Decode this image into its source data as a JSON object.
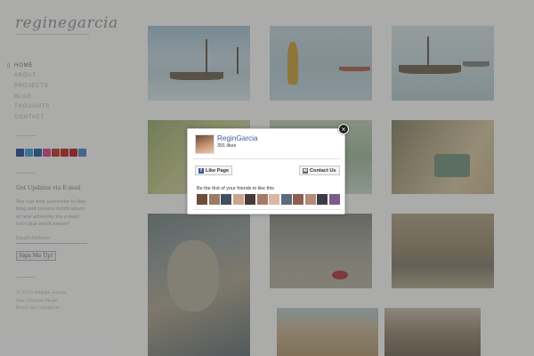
{
  "site": {
    "logo_text": "reginegarcia"
  },
  "nav": {
    "items": [
      {
        "label": "HOME",
        "active": true
      },
      {
        "label": "ABOUT",
        "active": false
      },
      {
        "label": "PROJECTS",
        "active": false
      },
      {
        "label": "BLOG",
        "active": false
      },
      {
        "label": "THOUGHTS",
        "active": false
      },
      {
        "label": "CONTACT",
        "active": false
      }
    ]
  },
  "social_icons": [
    {
      "name": "facebook-icon",
      "color": "#3b5998"
    },
    {
      "name": "twitter-icon",
      "color": "#4aa3d8"
    },
    {
      "name": "linkedin-icon",
      "color": "#2f6fa3"
    },
    {
      "name": "flickr-icon",
      "color": "#d9549a"
    },
    {
      "name": "google-plus-icon",
      "color": "#c5463a"
    },
    {
      "name": "youtube-icon",
      "color": "#c33b2f"
    },
    {
      "name": "pinterest-icon",
      "color": "#b8343a"
    },
    {
      "name": "email-icon",
      "color": "#5b8fc9"
    }
  ],
  "subscribe": {
    "title": "Get Updates via E-mail",
    "text": "You can now subscribe to this blog and receive notifications of new artworks via e-mail! Isn't that much easier?",
    "email_placeholder": "Email Address",
    "button_label": "Sign Me Up!"
  },
  "footer": {
    "line1": "© 2015 Regine Garcia",
    "line2": "See Chrome Mode",
    "line3": "Read the Colophon"
  },
  "fb_popup": {
    "page_name": "ReginGarcia",
    "likes": "391 likes",
    "like_button": "Like Page",
    "contact_button": "Contact Us",
    "friends_text": "Be the first of your friends to like this",
    "close_symbol": "×",
    "like_icon_glyph": "f",
    "contact_icon_glyph": "✉"
  },
  "colors": {
    "fb_blue": "#3b5998",
    "overlay": "rgba(30,30,30,0.35)"
  }
}
